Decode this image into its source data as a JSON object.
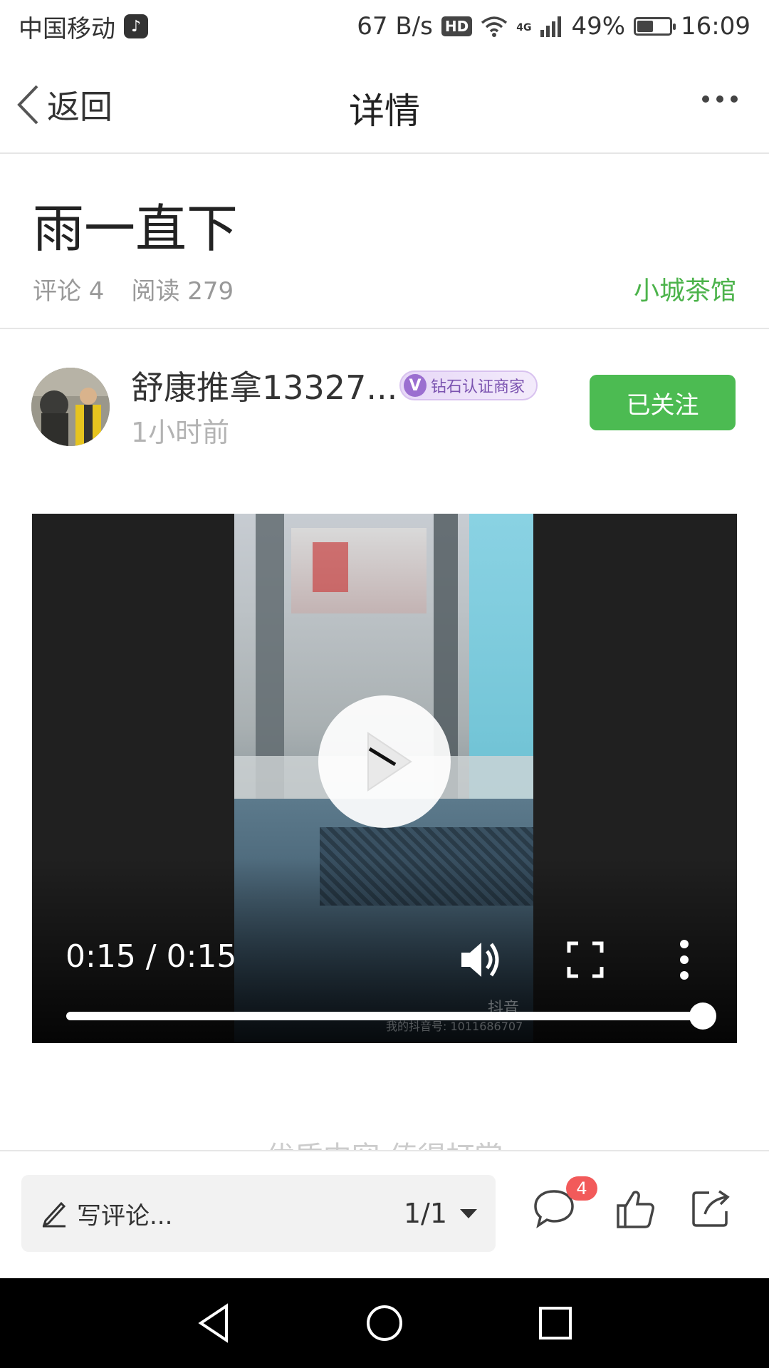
{
  "status_bar": {
    "carrier": "中国移动",
    "app_badge": "♪",
    "net_speed": "67 B/s",
    "hd": "HD",
    "network_type": "4G",
    "battery_percent": "49%",
    "battery_level": 0.49,
    "time": "16:09"
  },
  "nav": {
    "back_label": "返回",
    "title": "详情"
  },
  "article": {
    "title": "雨一直下",
    "comments_label": "评论 4",
    "reads_label": "阅读 279",
    "circle_name": "小城茶馆"
  },
  "author": {
    "name": "舒康推拿13327...",
    "badge": "钻石认证商家",
    "badge_mark": "V",
    "time": "1小时前",
    "follow_label": "已关注"
  },
  "video": {
    "time_display": "0:15 / 0:15",
    "progress": 1.0,
    "watermark_brand": "抖音",
    "watermark_id": "我的抖音号: 1011686707"
  },
  "peek_text": "优质内容 值得打赏",
  "bottom_bar": {
    "comment_placeholder": "写评论...",
    "page_indicator": "1/1",
    "comment_count": "4"
  },
  "colors": {
    "accent_green": "#4cbb52",
    "badge_red": "#f25a5a",
    "badge_purple": "#9b6fd0"
  },
  "icons": [
    "back-chevron-icon",
    "more-icon",
    "play-icon",
    "volume-icon",
    "fullscreen-icon",
    "overflow-icon",
    "pencil-icon",
    "comment-icon",
    "like-icon",
    "share-icon",
    "nav-back-icon",
    "nav-home-icon",
    "nav-recents-icon"
  ]
}
